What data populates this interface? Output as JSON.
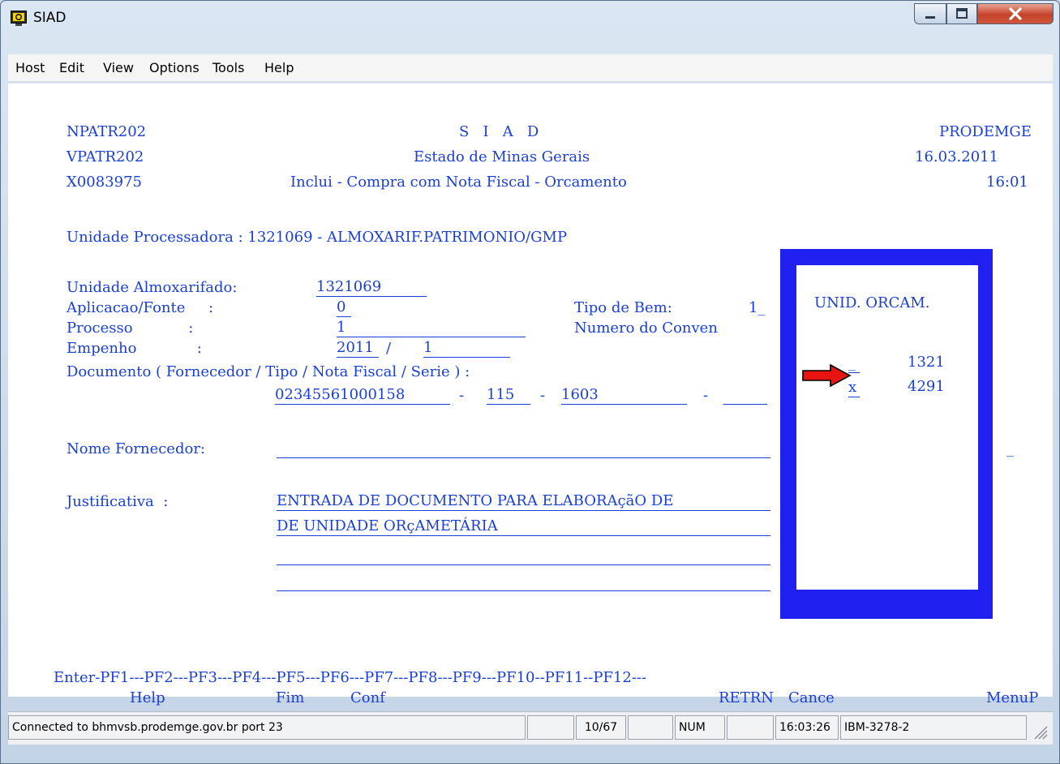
{
  "window": {
    "title": "SIAD"
  },
  "menu": [
    "Host",
    "Edit",
    "View",
    "Options",
    "Tools",
    "Help"
  ],
  "header": {
    "program": "NPATR202",
    "view": "VPATR202",
    "user": "X0083975",
    "system": "S   I   A   D",
    "state": "Estado de Minas Gerais",
    "operation": "Inclui - Compra com Nota Fiscal - Orcamento",
    "org": "PRODEMGE",
    "date": "16.03.2011",
    "time": "16:01"
  },
  "form": {
    "unidade_processadora": "Unidade Processadora : 1321069 - ALMOXARIF.PATRIMONIO/GMP",
    "almox_label": "Unidade Almoxarifado:",
    "almox_value": "1321069",
    "aplicacao_label": "Aplicacao/Fonte     :",
    "aplicacao_value": "0",
    "processo_label": "Processo            :",
    "processo_value": "1",
    "empenho_label": "Empenho             :",
    "empenho_year": "2011",
    "empenho_slash": "/",
    "empenho_value": "1",
    "tipo_bem_label": "Tipo de Bem:",
    "tipo_bem_value": "1_",
    "convenio_label": "Numero do Conven",
    "documento_label": "Documento ( Fornecedor / Tipo / Nota Fiscal / Serie ) :",
    "doc_fornecedor": "02345561000158",
    "doc_sep1": "-",
    "doc_tipo": "115",
    "doc_sep2": "-",
    "doc_nf": "1603",
    "doc_sep3": "-",
    "nome_label": "Nome Fornecedor:",
    "justificativa_label": "Justificativa  :",
    "justificativa_1": "ENTRADA DE DOCUMENTO PARA ELABORAçãO DE",
    "justificativa_2": "DE UNIDADE ORçAMETÁRIA"
  },
  "popup": {
    "header": "UNID. ORCAM.",
    "rows": [
      {
        "sel": "_",
        "code": "1321"
      },
      {
        "sel": "x",
        "code": "4291"
      }
    ],
    "arrow_color": "#e8140f"
  },
  "pfkeys": {
    "line": "Enter-PF1---PF2---PF3---PF4---PF5---PF6---PF7---PF8---PF9---PF10--PF11--PF12---",
    "help": "Help",
    "fim": "Fim",
    "conf": "Conf",
    "retrn": "RETRN",
    "cance": "Cance",
    "menup": "MenuP"
  },
  "status": {
    "connection": "Connected to bhmvsb.prodemge.gov.br port 23",
    "cursor": "10/67",
    "num": "NUM",
    "time": "16:03:26",
    "terminal": "IBM-3278-2"
  },
  "colors": {
    "terminal_text": "#1a3fd9",
    "popup_border": "#2020f0"
  }
}
